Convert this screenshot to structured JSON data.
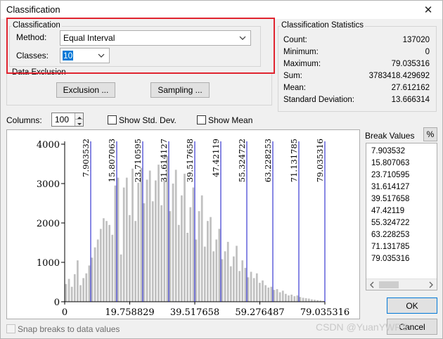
{
  "window": {
    "title": "Classification",
    "close_glyph": "✕"
  },
  "classification": {
    "legend": "Classification",
    "method_label": "Method:",
    "method_value": "Equal Interval",
    "classes_label": "Classes:",
    "classes_value": "10"
  },
  "data_exclusion": {
    "legend": "Data Exclusion",
    "exclusion_button": "Exclusion ...",
    "sampling_button": "Sampling ..."
  },
  "statistics": {
    "legend": "Classification Statistics",
    "rows": [
      {
        "label": "Count:",
        "value": "137020"
      },
      {
        "label": "Minimum:",
        "value": "0"
      },
      {
        "label": "Maximum:",
        "value": "79.035316"
      },
      {
        "label": "Sum:",
        "value": "3783418.429692"
      },
      {
        "label": "Mean:",
        "value": "27.612162"
      },
      {
        "label": "Standard Deviation:",
        "value": "13.666314"
      }
    ]
  },
  "toolbar": {
    "columns_label": "Columns:",
    "columns_value": "100",
    "show_std_dev": "Show Std. Dev.",
    "show_mean": "Show Mean"
  },
  "break_values": {
    "label": "Break Values",
    "percent_button": "%",
    "values": [
      "7.903532",
      "15.807063",
      "23.710595",
      "31.614127",
      "39.517658",
      "47.42119",
      "55.324722",
      "63.228253",
      "71.131785",
      "79.035316"
    ]
  },
  "bottom": {
    "snap_label": "Snap breaks to data values",
    "ok_button": "OK",
    "cancel_button": "Cancel",
    "watermark": "CSDN @YuanYWRS"
  },
  "chart_data": {
    "type": "bar",
    "title": "",
    "xlabel": "",
    "ylabel": "",
    "xlim": [
      0,
      79.035316
    ],
    "ylim": [
      0,
      4000
    ],
    "y_ticks": [
      0,
      1000,
      2000,
      3000,
      4000
    ],
    "x_ticks": [
      0,
      19.758829,
      39.517658,
      59.276487,
      79.035316
    ],
    "x_tick_labels": [
      "0",
      "19.758829",
      "39.517658",
      "59.276487",
      "79.035316"
    ],
    "breaks": [
      7.903532,
      15.807063,
      23.710595,
      31.614127,
      39.517658,
      47.42119,
      55.324722,
      63.228253,
      71.131785,
      79.035316
    ],
    "break_labels": [
      "7.903532",
      "15.807063",
      "23.710595",
      "31.614127",
      "39.517658",
      "47.42119",
      "55.324722",
      "63.228253",
      "71.131785",
      "79.035316"
    ],
    "bar_color": "#c0c0c0",
    "break_color": "#1010c8",
    "values": [
      450,
      580,
      380,
      700,
      1050,
      420,
      600,
      720,
      920,
      1120,
      1380,
      1580,
      1850,
      2120,
      2050,
      1950,
      1700,
      2950,
      3150,
      1200,
      2900,
      3150,
      2200,
      3380,
      2050,
      3020,
      3400,
      2500,
      3100,
      3330,
      2550,
      3080,
      3480,
      2450,
      3100,
      3700,
      2300,
      3000,
      3350,
      1950,
      2700,
      3250,
      1750,
      2400,
      2900,
      1580,
      2300,
      2700,
      1400,
      2050,
      2150,
      1280,
      1580,
      1850,
      1080,
      1280,
      1520,
      900,
      1150,
      1420,
      780,
      1050,
      860,
      620,
      760,
      600,
      720,
      480,
      540,
      420,
      360,
      380,
      300,
      320,
      240,
      280,
      200,
      160,
      180,
      140,
      160,
      120,
      100,
      90,
      80,
      60,
      50,
      40,
      30,
      20
    ]
  }
}
